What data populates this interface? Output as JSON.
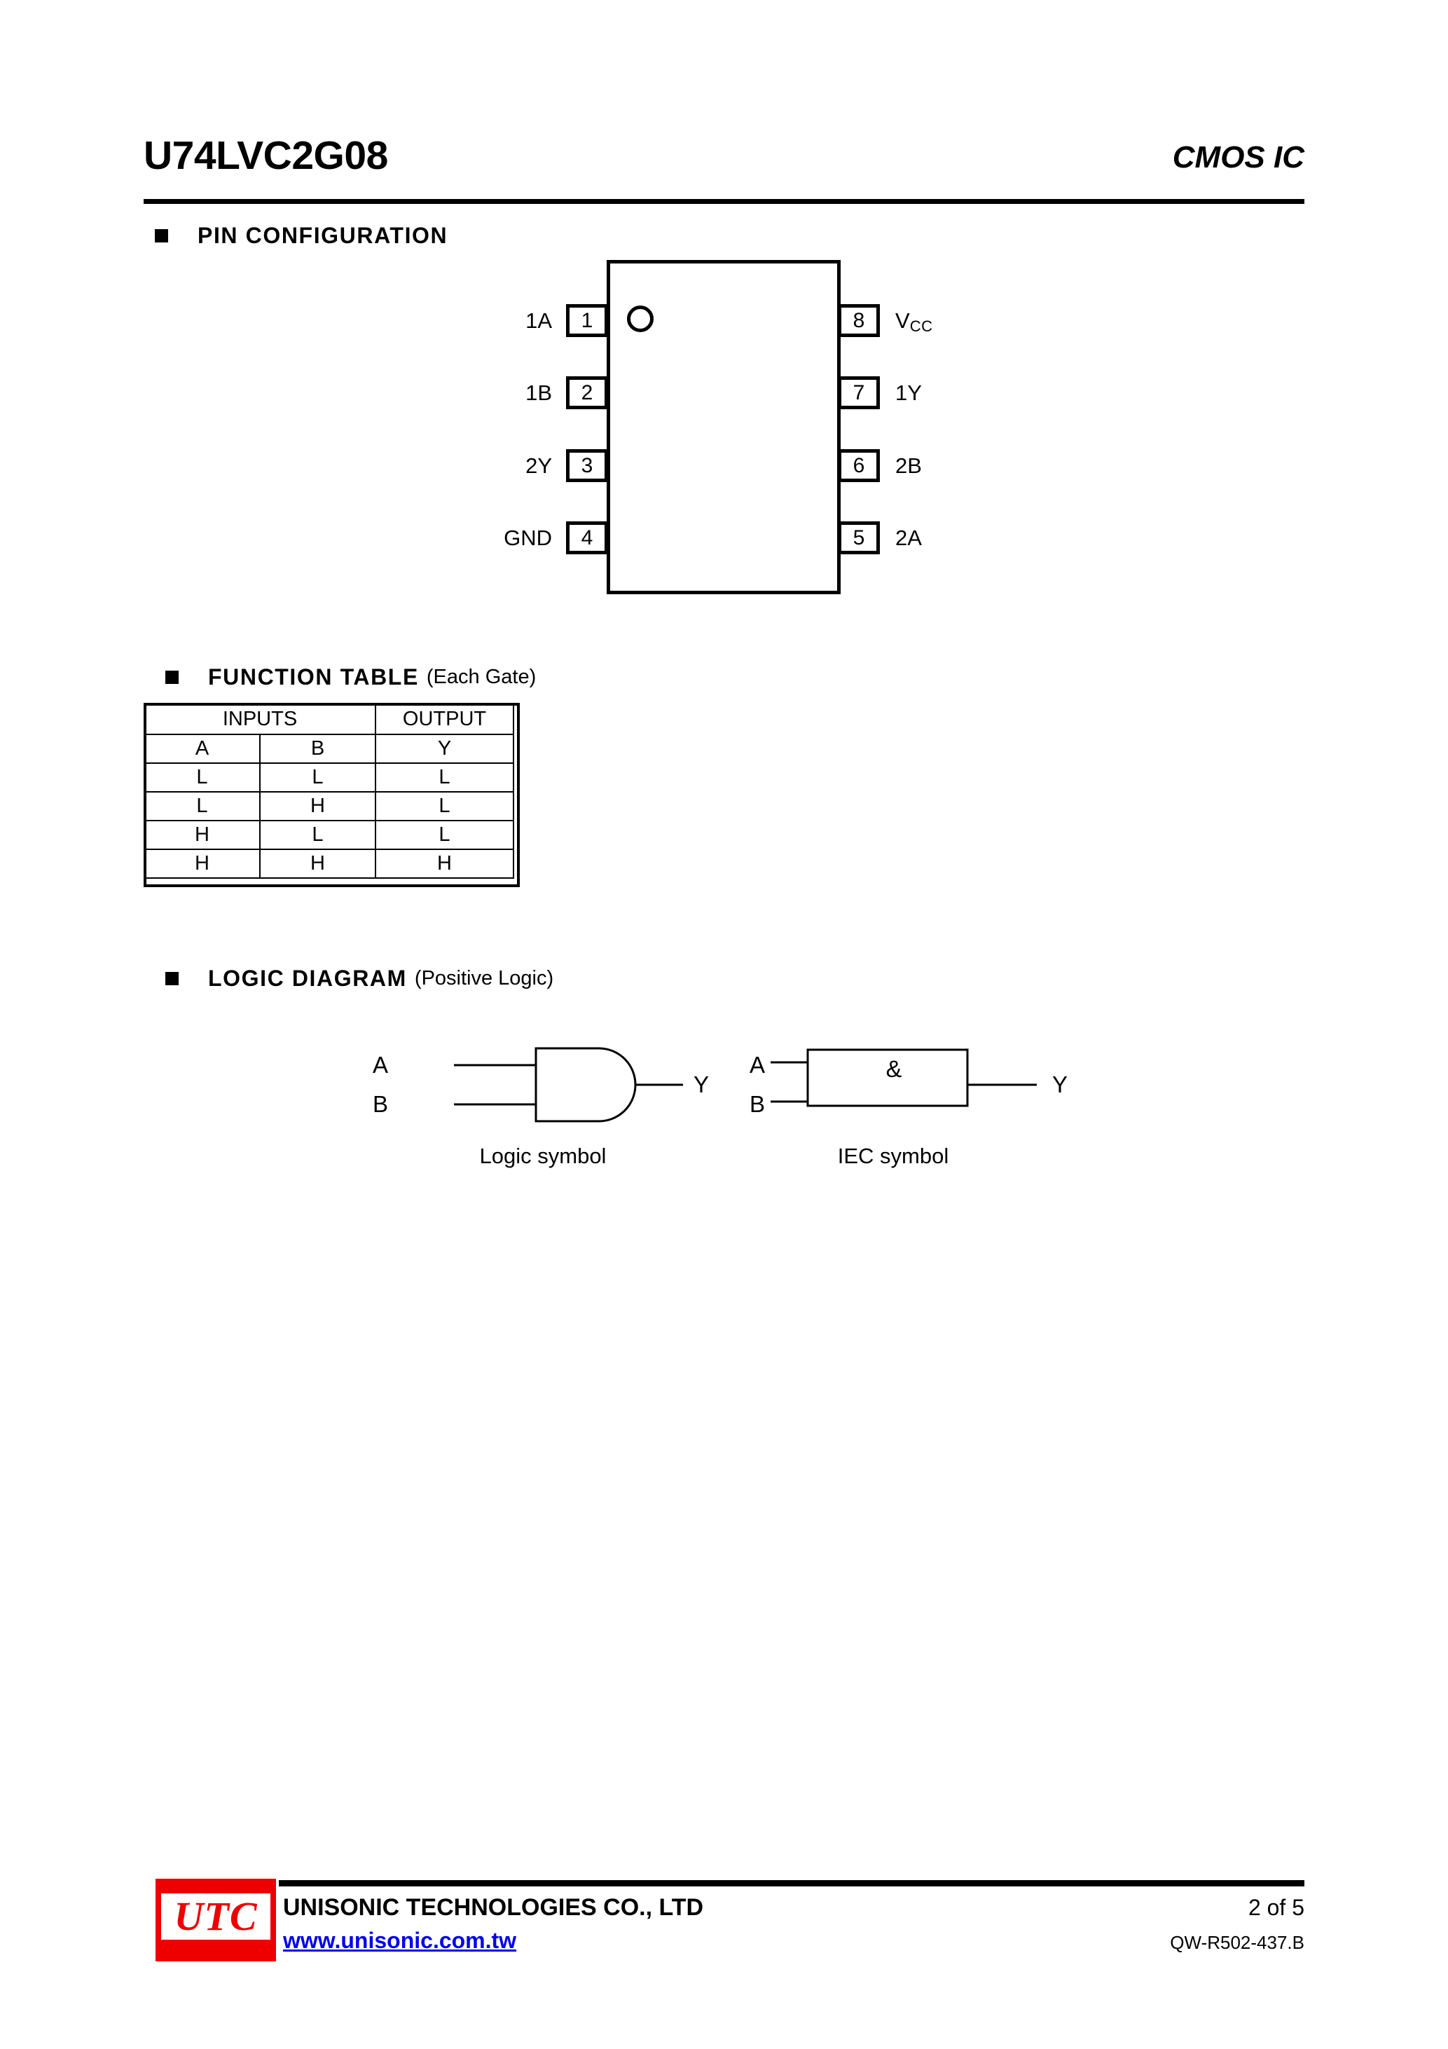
{
  "header": {
    "part_number": "U74LVC2G08",
    "family": "CMOS IC"
  },
  "sections": {
    "pin_configuration": {
      "title": "PIN CONFIGURATION",
      "subtitle": ""
    },
    "function_table": {
      "title": "FUNCTION TABLE",
      "subtitle": "(Each Gate)"
    },
    "logic_diagram": {
      "title": "LOGIC DIAGRAM",
      "subtitle": "(Positive Logic)"
    }
  },
  "pin_configuration": {
    "left_pins": [
      {
        "number": "1",
        "label": "1A"
      },
      {
        "number": "2",
        "label": "1B"
      },
      {
        "number": "3",
        "label": "2Y"
      },
      {
        "number": "4",
        "label": "GND"
      }
    ],
    "right_pins": [
      {
        "number": "8",
        "label": "V",
        "subscript": "CC"
      },
      {
        "number": "7",
        "label": "1Y",
        "subscript": ""
      },
      {
        "number": "6",
        "label": "2B",
        "subscript": ""
      },
      {
        "number": "5",
        "label": "2A",
        "subscript": ""
      }
    ],
    "pin1_indicator": "circle-dot"
  },
  "function_table": {
    "group_headers": {
      "inputs": "INPUTS",
      "output": "OUTPUT"
    },
    "columns": [
      "A",
      "B",
      "Y"
    ],
    "rows": [
      [
        "L",
        "L",
        "L"
      ],
      [
        "L",
        "H",
        "L"
      ],
      [
        "H",
        "L",
        "L"
      ],
      [
        "H",
        "H",
        "H"
      ]
    ]
  },
  "logic_diagram": {
    "logic_symbol": {
      "caption": "Logic symbol",
      "input_a": "A",
      "input_b": "B",
      "output": "Y"
    },
    "iec_symbol": {
      "caption": "IEC symbol",
      "input_a": "A",
      "input_b": "B",
      "output": "Y",
      "operator": "&"
    }
  },
  "footer": {
    "logo_text": "UTC",
    "logo_color": "#ee0000",
    "company": "UNISONIC TECHNOLOGIES CO., LTD",
    "url": "www.unisonic.com.tw",
    "url_color": "#0000ee",
    "page": "2 of 5",
    "doc_code": "QW-R502-437.B"
  }
}
